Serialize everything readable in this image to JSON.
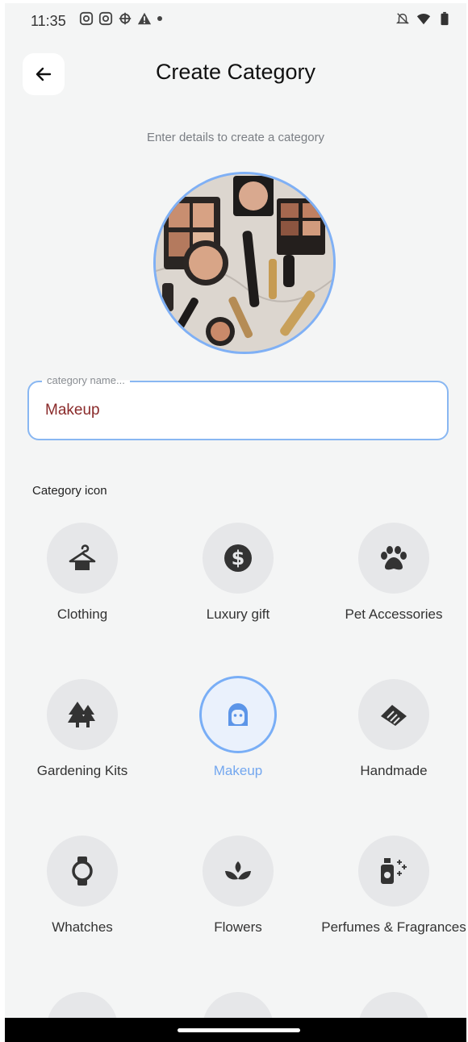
{
  "status_bar": {
    "time": "11:35"
  },
  "header": {
    "title": "Create Category"
  },
  "subtitle": "Enter details to create a category",
  "name_field": {
    "label": "category name...",
    "value": "Makeup"
  },
  "section_label": "Category icon",
  "icons": [
    {
      "label": "Clothing",
      "icon": "hanger-icon",
      "selected": false
    },
    {
      "label": "Luxury gift",
      "icon": "dollar-icon",
      "selected": false
    },
    {
      "label": "Pet Accessories",
      "icon": "paw-icon",
      "selected": false
    },
    {
      "label": "Gardening Kits",
      "icon": "trees-icon",
      "selected": false
    },
    {
      "label": "Makeup",
      "icon": "face-icon",
      "selected": true
    },
    {
      "label": "Handmade",
      "icon": "handshake-icon",
      "selected": false
    },
    {
      "label": "Whatches",
      "icon": "watch-icon",
      "selected": false
    },
    {
      "label": "Flowers",
      "icon": "lotus-icon",
      "selected": false
    },
    {
      "label": "Perfumes & Fragrances",
      "icon": "perfume-icon",
      "selected": false
    }
  ],
  "colors": {
    "accent": "#79aef6",
    "background": "#f4f5f5",
    "input_text": "#8a2a2a",
    "icon_fg": "#333333"
  }
}
